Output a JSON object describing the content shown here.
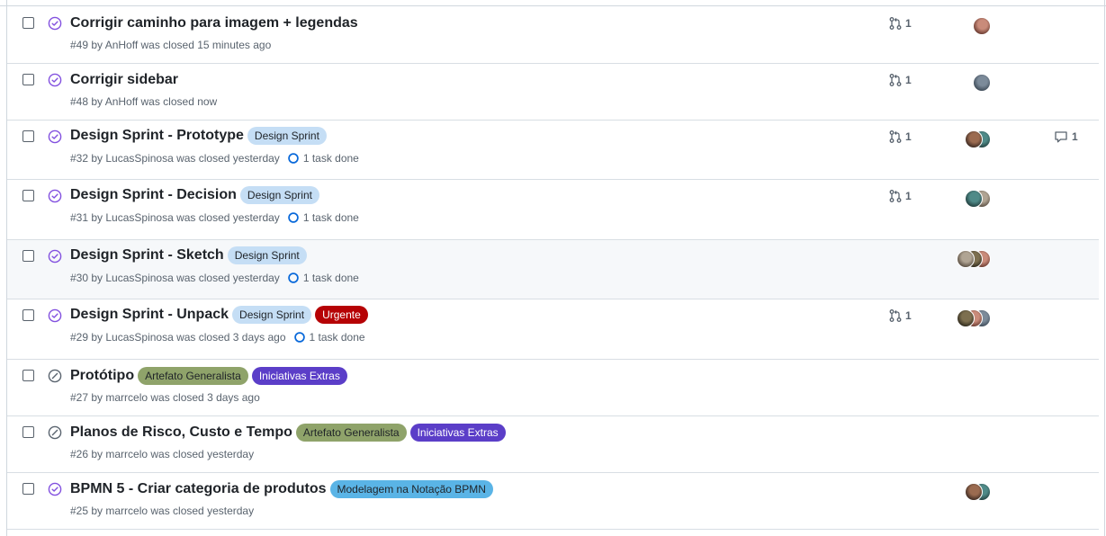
{
  "colors": {
    "closed_completed": "#8250df",
    "closed_not_planned": "#59636e",
    "task_circle": "#0969da"
  },
  "issues": [
    {
      "title": "Corrigir caminho para imagem + legendas",
      "meta": "#49 by AnHoff was closed 15 minutes ago",
      "state_icon": "check-circle-icon",
      "labels": [],
      "task": "",
      "linked_prs": "1",
      "comments": "",
      "assignees": 1
    },
    {
      "title": "Corrigir sidebar",
      "meta": "#48 by AnHoff was closed now",
      "state_icon": "check-circle-icon",
      "labels": [],
      "task": "",
      "linked_prs": "1",
      "comments": "",
      "assignees": 1
    },
    {
      "title": "Design Sprint - Prototype",
      "meta": "#32 by LucasSpinosa was closed yesterday",
      "state_icon": "check-circle-icon",
      "labels": [
        {
          "text": "Design Sprint",
          "bg": "#c5def5",
          "fg": "#1f2328"
        }
      ],
      "task": "1 task done",
      "linked_prs": "1",
      "comments": "1",
      "assignees": 2
    },
    {
      "title": "Design Sprint - Decision",
      "meta": "#31 by LucasSpinosa was closed yesterday",
      "state_icon": "check-circle-icon",
      "labels": [
        {
          "text": "Design Sprint",
          "bg": "#c5def5",
          "fg": "#1f2328"
        }
      ],
      "task": "1 task done",
      "linked_prs": "1",
      "comments": "",
      "assignees": 2
    },
    {
      "title": "Design Sprint - Sketch",
      "meta": "#30 by LucasSpinosa was closed yesterday",
      "state_icon": "check-circle-icon",
      "labels": [
        {
          "text": "Design Sprint",
          "bg": "#c5def5",
          "fg": "#1f2328"
        }
      ],
      "task": "1 task done",
      "linked_prs": "",
      "comments": "",
      "assignees": 3
    },
    {
      "title": "Design Sprint - Unpack",
      "meta": "#29 by LucasSpinosa was closed 3 days ago",
      "state_icon": "check-circle-icon",
      "labels": [
        {
          "text": "Design Sprint",
          "bg": "#c5def5",
          "fg": "#1f2328"
        },
        {
          "text": "Urgente",
          "bg": "#b60205",
          "fg": "#ffffff"
        }
      ],
      "task": "1 task done",
      "linked_prs": "1",
      "comments": "",
      "assignees": 3
    },
    {
      "title": "Protótipo",
      "meta": "#27 by marrcelo was closed 3 days ago",
      "state_icon": "skip-circle-icon",
      "labels": [
        {
          "text": "Artefato Generalista",
          "bg": "#8fa36a",
          "fg": "#1f2328"
        },
        {
          "text": "Iniciativas Extras",
          "bg": "#5b3ec8",
          "fg": "#ffffff"
        }
      ],
      "task": "",
      "linked_prs": "",
      "comments": "",
      "assignees": 0
    },
    {
      "title": "Planos de Risco, Custo e Tempo",
      "meta": "#26 by marrcelo was closed yesterday",
      "state_icon": "skip-circle-icon",
      "labels": [
        {
          "text": "Artefato Generalista",
          "bg": "#8fa36a",
          "fg": "#1f2328"
        },
        {
          "text": "Iniciativas Extras",
          "bg": "#5b3ec8",
          "fg": "#ffffff"
        }
      ],
      "task": "",
      "linked_prs": "",
      "comments": "",
      "assignees": 0
    },
    {
      "title": "BPMN 5 - Criar categoria de produtos",
      "meta": "#25 by marrcelo was closed yesterday",
      "state_icon": "check-circle-icon",
      "labels": [
        {
          "text": "Modelagem na Notação BPMN",
          "bg": "#5ab4e6",
          "fg": "#1f2328"
        }
      ],
      "task": "",
      "linked_prs": "",
      "comments": "",
      "assignees": 2
    }
  ]
}
